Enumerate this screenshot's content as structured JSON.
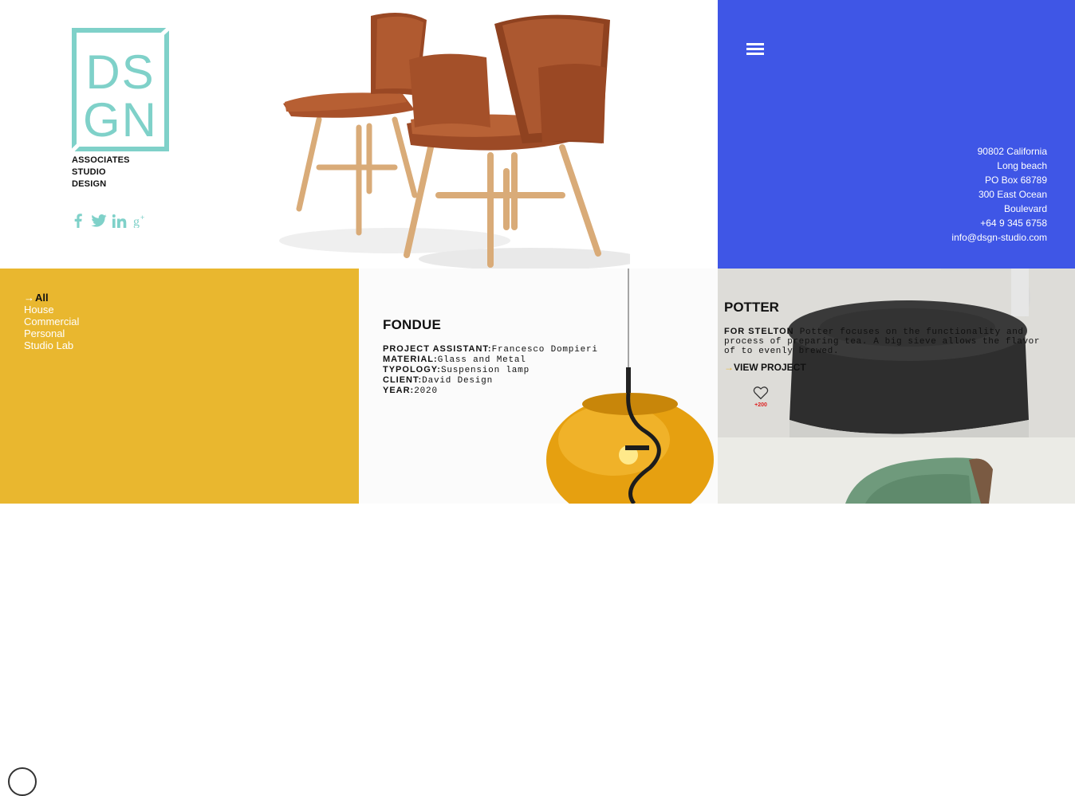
{
  "brand": {
    "logo_letters": "DSGN",
    "tagline": [
      "ASSOCIATES",
      "STUDIO",
      "DESIGN"
    ],
    "color": "#7fd1c9"
  },
  "social": [
    {
      "name": "facebook-icon"
    },
    {
      "name": "twitter-icon"
    },
    {
      "name": "linkedin-icon"
    },
    {
      "name": "google-plus-icon"
    }
  ],
  "contact": {
    "background": "#3f56e6",
    "lines": [
      "90802 California",
      "Long beach",
      "PO Box 68789",
      "300 East Ocean",
      "Boulevard",
      "+64 9 345 6758",
      "info@dsgn-studio.com"
    ]
  },
  "filters": {
    "background": "#e9b72f",
    "arrow": "→",
    "items": [
      {
        "label": "All",
        "active": true
      },
      {
        "label": "House"
      },
      {
        "label": "Commercial"
      },
      {
        "label": "Personal"
      },
      {
        "label": "Studio Lab"
      }
    ]
  },
  "fondue": {
    "title": "FONDUE",
    "specs": [
      {
        "key": "PROJECT ASSISTANT:",
        "value": "Francesco Dompieri"
      },
      {
        "key": "MATERIAL:",
        "value": "Glass and Metal"
      },
      {
        "key": "TYPOLOGY:",
        "value": "Suspension lamp"
      },
      {
        "key": "CLIENT:",
        "value": "David Design"
      },
      {
        "key": "YEAR:",
        "value": "2020"
      }
    ]
  },
  "potter": {
    "title": "POTTER",
    "desc_lead": "FOR STELTON",
    "desc_body": " Potter focuses on the functionality and process of preparing tea. A big sieve allows the flavor of to evenly brewed.",
    "arrow": "→",
    "cta": "VIEW PROJECT",
    "likes": "+200"
  }
}
